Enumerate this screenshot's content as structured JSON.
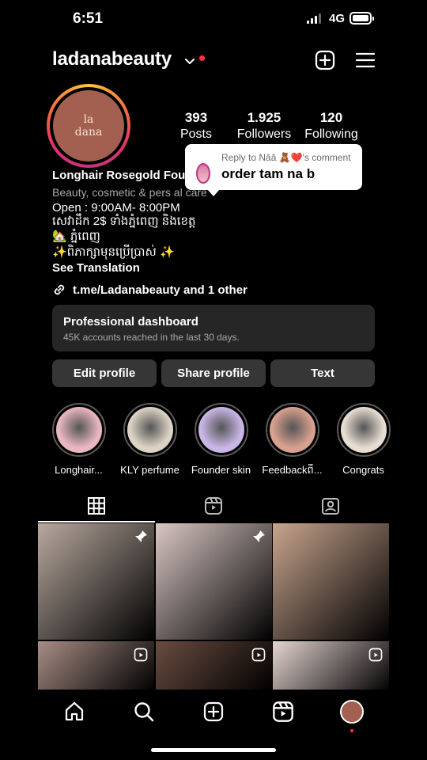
{
  "status_bar": {
    "time": "6:51",
    "network": "4G"
  },
  "header": {
    "username": "ladanabeauty"
  },
  "profile": {
    "avatar_text": [
      "la",
      "dana"
    ],
    "stats": [
      {
        "value": "393",
        "label": "Posts"
      },
      {
        "value": "1.925",
        "label": "Followers"
      },
      {
        "value": "120",
        "label": "Following"
      }
    ],
    "name": "Longhair Rosegold Fou",
    "category": "Beauty, cosmetic & pers   al care",
    "bio_lines": [
      "Open : 9:00AM- 8:00PM",
      "សេវាដឹក 2$ ទាំងភ្នំពេញ និងខេត្ត",
      "🏡 ភ្នំពេញ",
      "✨ពិភាក្សាមុនប្រើប្រាស់ ✨"
    ],
    "see_translation": "See Translation",
    "link": "t.me/Ladanabeauty and 1 other"
  },
  "reply_bubble": {
    "header": "Reply to Nââ 🧸❤️'s comment",
    "text": "order tam na b"
  },
  "dashboard": {
    "title": "Professional dashboard",
    "subtitle": "45K accounts reached in the last 30 days."
  },
  "actions": [
    "Edit profile",
    "Share profile",
    "Text"
  ],
  "highlights": [
    {
      "label": "Longhair...",
      "color": "#e9b7c1"
    },
    {
      "label": "KLY perfume",
      "color": "#dcd3c4"
    },
    {
      "label": "Founder skin",
      "color": "#c9b6e6"
    },
    {
      "label": "Feedbackពី...",
      "color": "#d8a08f"
    },
    {
      "label": "Congrats",
      "color": "#e8ddd2"
    }
  ],
  "tabs": [
    "grid-icon",
    "reels-icon",
    "tagged-icon"
  ],
  "grid_posts": [
    {
      "color": "#b9a99f",
      "icon": "pin-icon"
    },
    {
      "color": "#d9c7c3",
      "icon": "pin-icon"
    },
    {
      "color": "#c9a58e",
      "icon": "pin-icon"
    },
    {
      "color": "#a88d84",
      "icon": "reel-icon"
    },
    {
      "color": "#6a4c40",
      "icon": "reel-icon"
    },
    {
      "color": "#e5d5d1",
      "icon": "reel-icon"
    }
  ],
  "bottom_nav": [
    "home-icon",
    "search-icon",
    "create-icon",
    "reels-icon",
    "profile-avatar"
  ]
}
